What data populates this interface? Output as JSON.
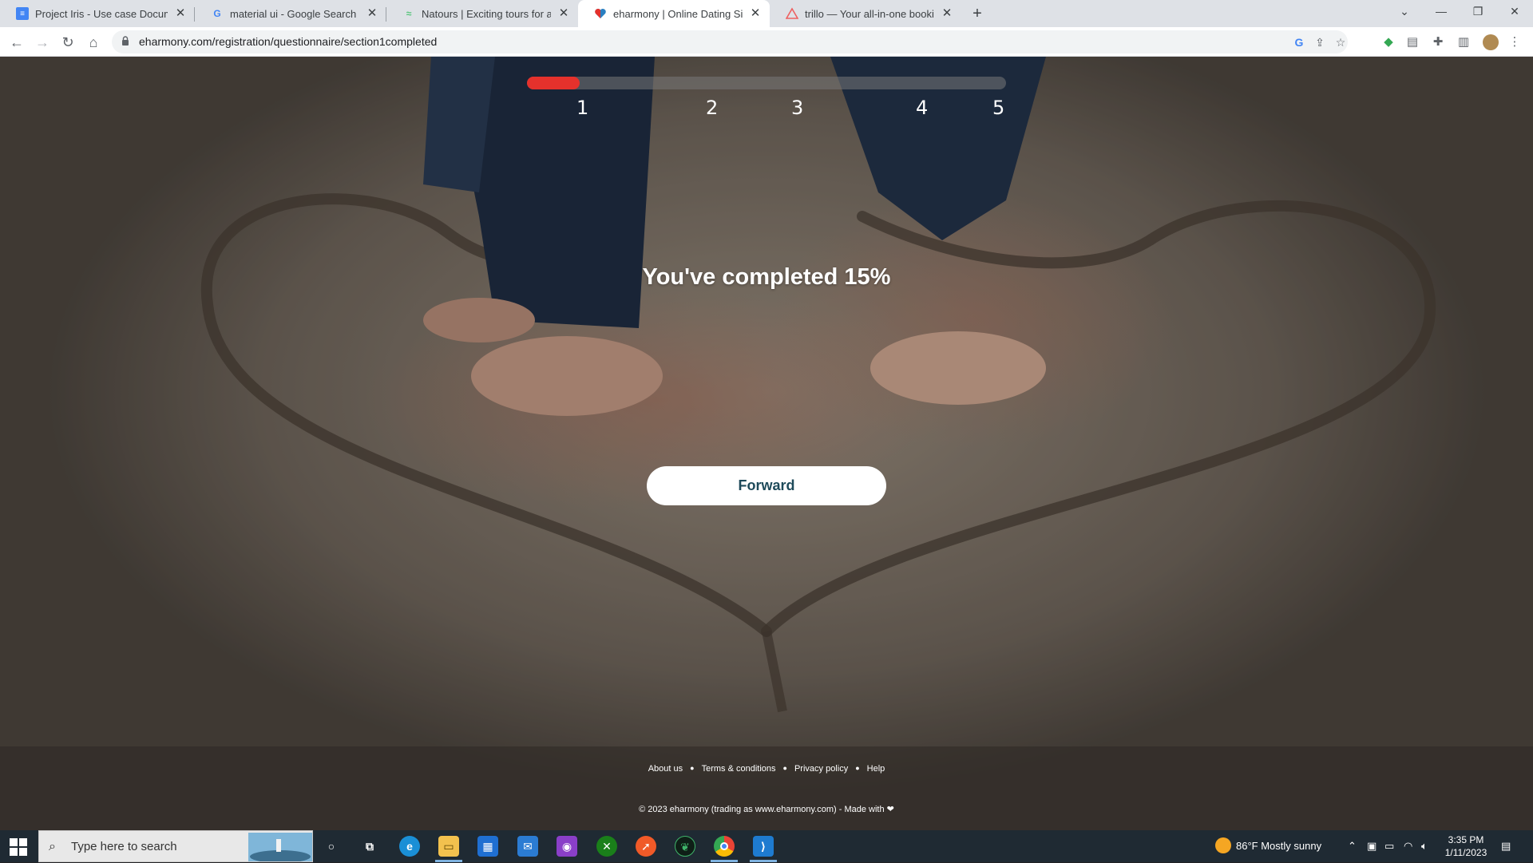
{
  "browser": {
    "tabs": [
      {
        "title": "Project Iris - Use case Document",
        "favicon": "docs-icon",
        "active": false
      },
      {
        "title": "material ui - Google Search",
        "favicon": "google-icon",
        "active": false
      },
      {
        "title": "Natours | Exciting tours for adventurous people",
        "favicon": "natours-icon",
        "active": false
      },
      {
        "title": "eharmony | Online Dating Site for Singles",
        "favicon": "eharmony-icon",
        "active": true
      },
      {
        "title": "trillo — Your all-in-one booking app",
        "favicon": "trillo-icon",
        "active": false
      }
    ],
    "new_tab_symbol": "+",
    "url": "eharmony.com/registration/questionnaire/section1completed"
  },
  "page": {
    "progress": {
      "fraction": 0.11,
      "color": "#e5312c",
      "steps": [
        "1",
        "2",
        "3",
        "4",
        "5"
      ]
    },
    "headline": "You've completed 15%",
    "forward_label": "Forward",
    "footer": {
      "links": [
        "About us",
        "Terms & conditions",
        "Privacy policy",
        "Help"
      ],
      "copyright": "© 2023 eharmony (trading as www.eharmony.com) - Made with",
      "heart_symbol": "❤"
    }
  },
  "taskbar": {
    "search_placeholder": "Type here to search",
    "weather": "86°F  Mostly sunny",
    "time": "3:35 PM",
    "date": "1/11/2023"
  }
}
